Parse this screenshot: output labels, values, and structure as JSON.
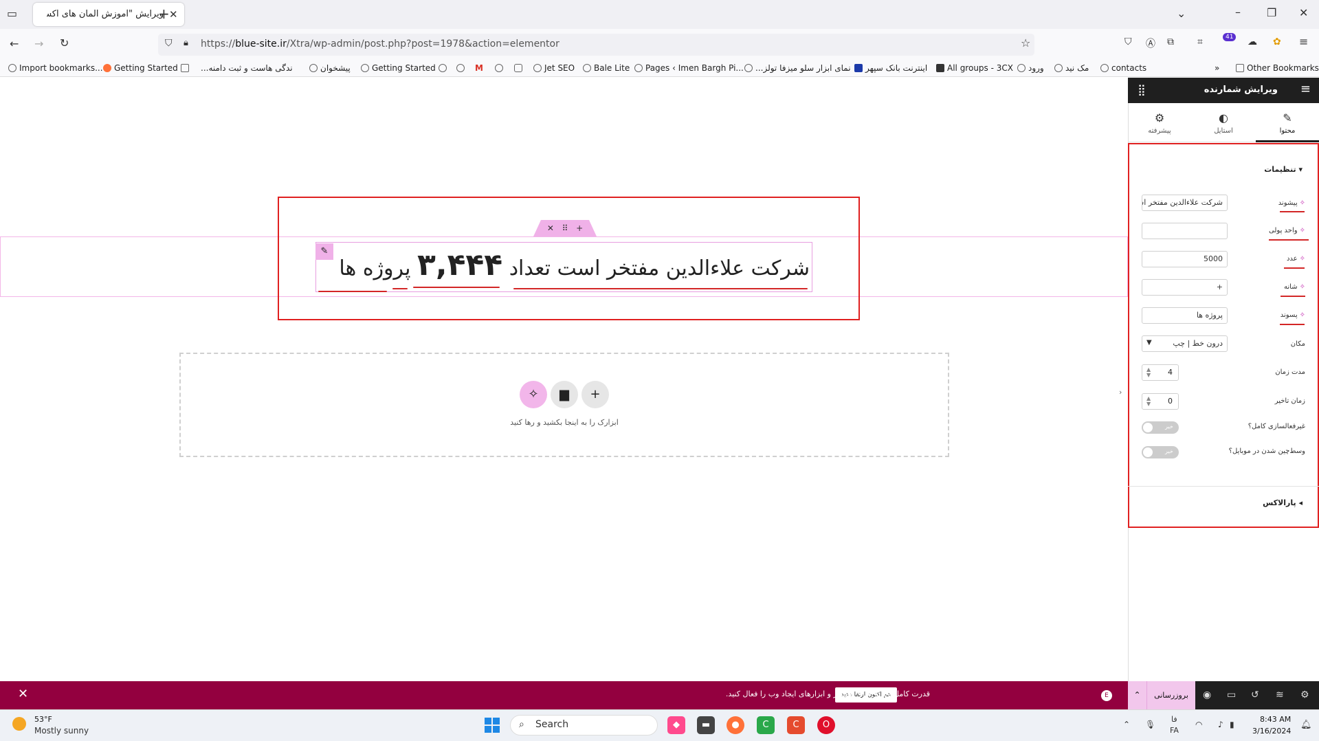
{
  "browser": {
    "tab_title": "ویرایش \"آموزش المان های اکسترا - عا",
    "url_prefix": "https://",
    "url_domain": "blue-site.ir",
    "url_path": "/Xtra/wp-admin/post.php?post=1978&action=elementor",
    "extension_badge": "41"
  },
  "bookmarks": [
    "Import bookmarks...",
    "Getting Started",
    "...ندگی هاست و ثبت دامنه",
    "پیشخوان",
    "Getting Started",
    "Jet SEO",
    "Bale Lite",
    "Pages ‹ Imen Bargh Pi...",
    "...نمای ابزار سلو میزفا تولز",
    "اینترنت بانک سپهر",
    "All groups - 3CX",
    "ورود",
    "مک نید",
    "contacts",
    "Other Bookmarks"
  ],
  "canvas": {
    "counter_prefix": "شرکت علاءالدین مفتخر است تعداد",
    "counter_number": "۳,۴۴۴",
    "counter_suffix": "پروژه ها",
    "drop_text": "ابزارک را به اینجا بکشید و رها کنید"
  },
  "panel": {
    "title": "ویرایش شمارنده",
    "tabs": [
      {
        "label": "محتوا",
        "icon": "pencil-icon"
      },
      {
        "label": "استایل",
        "icon": "half-circle-icon"
      },
      {
        "label": "پیشرفته",
        "icon": "gear-icon"
      }
    ],
    "section_title": "تنظیمات",
    "fields": {
      "prefix_label": "پیشوند",
      "prefix_value": "شرکت علاءالدین مفتخر است تعداد",
      "currency_label": "واحد پولی",
      "currency_value": "",
      "number_label": "عدد",
      "number_value": "5000",
      "separator_label": "شانه",
      "separator_value": "+",
      "suffix_label": "پسوند",
      "suffix_value": "پروژه ها",
      "position_label": "مکان",
      "position_value": "درون خط | چپ",
      "duration_label": "مدت زمان",
      "duration_value": "4",
      "delay_label": "زمان تاخیر",
      "delay_value": "0",
      "disable_all_label": "غیرفعالسازی کامل؟",
      "disable_all_toggle": "خیر",
      "mobile_center_label": "وسط‌چین شدن در موبایل؟",
      "mobile_center_toggle": "خیر"
    },
    "parallax_title": "پارالاکس"
  },
  "notice": {
    "text": "قدرت کامل ویژگی های المنتور و ابزارهای ایجاد وب را فعال کنید.",
    "button": "هم اکنون ارتقا دهید",
    "publish": "بروزرسانی"
  },
  "taskbar": {
    "temperature": "53°F",
    "weather": "Mostly sunny",
    "search": "Search",
    "lang_top": "فا",
    "lang_bottom": "FA",
    "time": "8:43 AM",
    "date": "3/16/2024"
  }
}
